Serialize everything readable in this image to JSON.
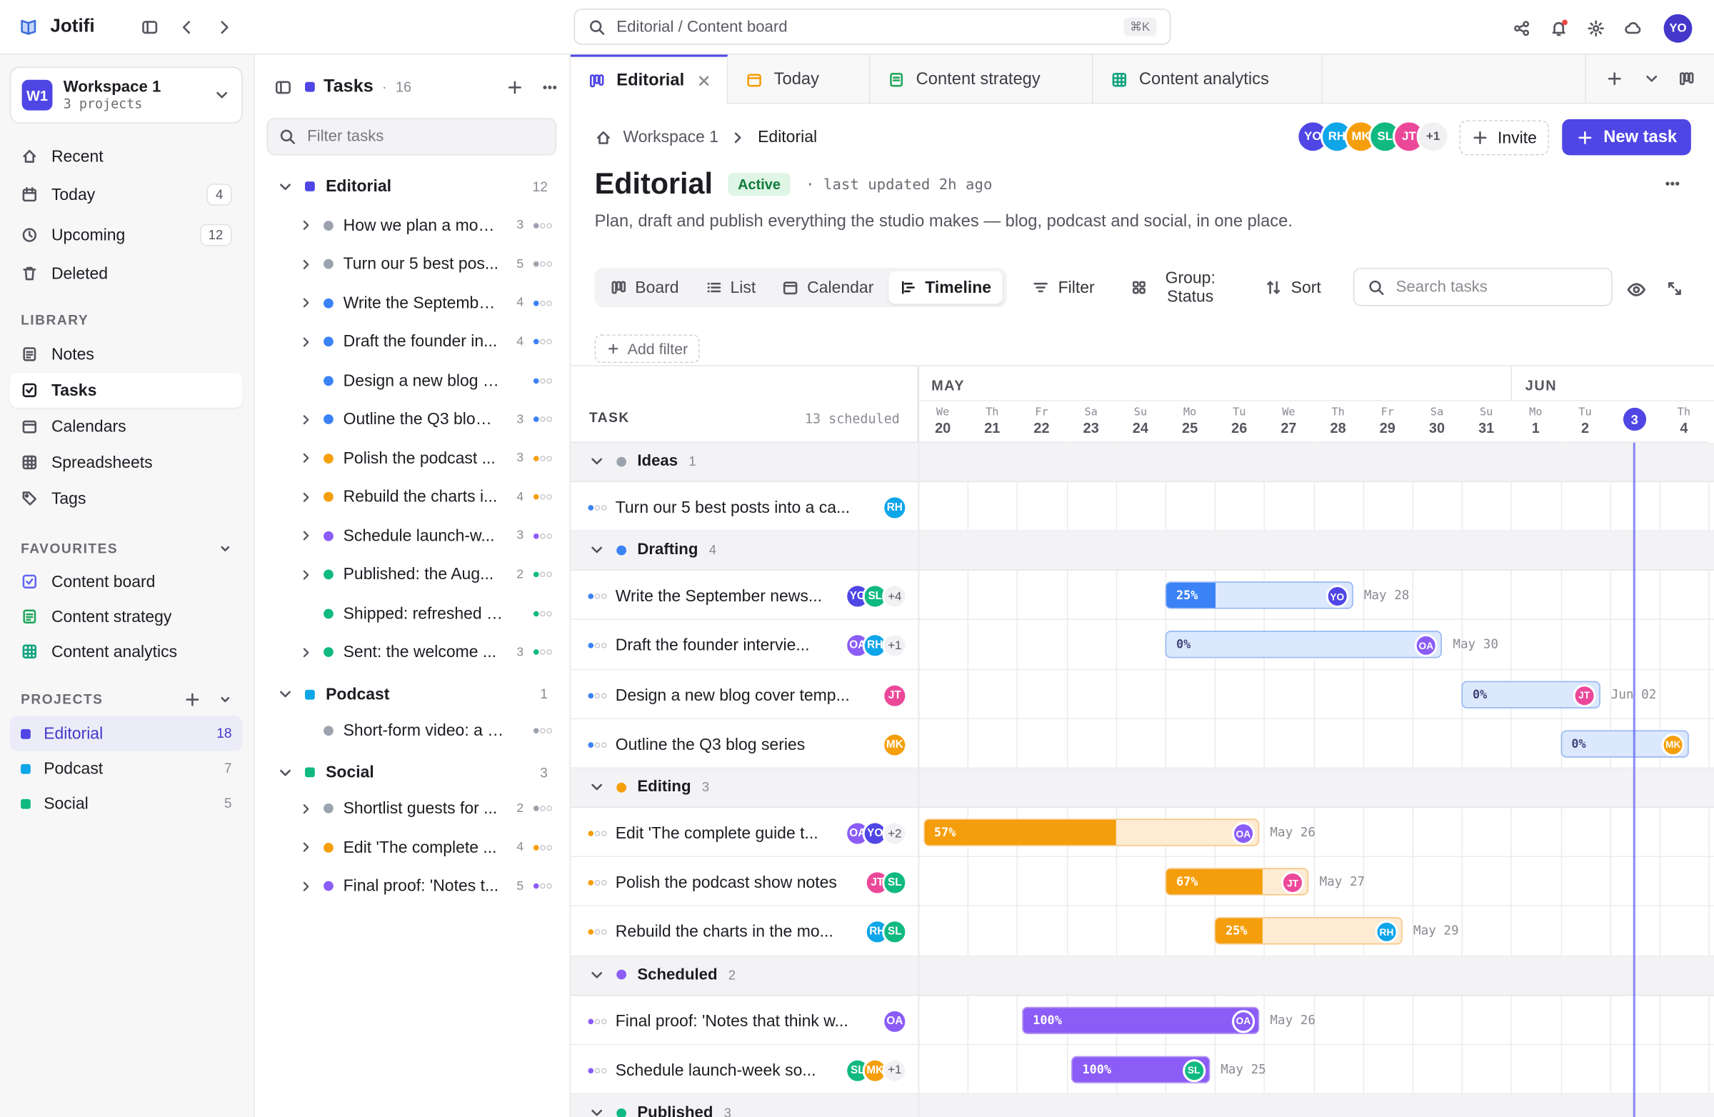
{
  "app": {
    "name": "Jotifi",
    "search": "Editorial / Content board",
    "shortcut": "⌘K",
    "user": "YO"
  },
  "workspace": {
    "name": "Workspace 1",
    "badge": "W1",
    "sub": "3 projects"
  },
  "nav": [
    {
      "label": "Recent",
      "icon": "clock-rewind-icon"
    },
    {
      "label": "Today",
      "count": "4",
      "icon": "calendar-icon"
    },
    {
      "label": "Upcoming",
      "count": "12",
      "icon": "clock-icon"
    },
    {
      "label": "Deleted",
      "icon": "trash-icon"
    }
  ],
  "library": {
    "title": "LIBRARY",
    "items": [
      "Notes",
      "Tasks",
      "Calendars",
      "Spreadsheets",
      "Tags"
    ]
  },
  "favourites": {
    "title": "FAVOURITES",
    "items": [
      "Content board",
      "Content strategy",
      "Content analytics"
    ]
  },
  "projects": {
    "title": "PROJECTS",
    "items": [
      {
        "label": "Editorial",
        "count": "18",
        "color": "#4f46e5"
      },
      {
        "label": "Podcast",
        "count": "7",
        "color": "#0ea5e9"
      },
      {
        "label": "Social",
        "count": "5",
        "color": "#10b981"
      }
    ]
  },
  "tasks_panel": {
    "title": "Tasks",
    "count": "16",
    "filter_placeholder": "Filter tasks",
    "groups": [
      {
        "name": "Editorial",
        "count": "12",
        "color": "#4f46e5",
        "items": [
          {
            "t": "How we plan a mon...",
            "n": "3",
            "c": "#9ca3af"
          },
          {
            "t": "Turn our 5 best pos...",
            "n": "5",
            "c": "#9ca3af"
          },
          {
            "t": "Write the Septembe...",
            "n": "4",
            "c": "#3b82f6"
          },
          {
            "t": "Draft the founder in...",
            "n": "4",
            "c": "#3b82f6"
          },
          {
            "t": "Design a new blog co...",
            "n": "",
            "c": "#3b82f6"
          },
          {
            "t": "Outline the Q3 blog ...",
            "n": "3",
            "c": "#3b82f6"
          },
          {
            "t": "Polish the podcast ...",
            "n": "3",
            "c": "#f59e0b"
          },
          {
            "t": "Rebuild the charts i...",
            "n": "4",
            "c": "#f59e0b"
          },
          {
            "t": "Schedule launch-w...",
            "n": "3",
            "c": "#8b5cf6"
          },
          {
            "t": "Published: the Aug...",
            "n": "2",
            "c": "#10b981"
          },
          {
            "t": "Shipped: refreshed br...",
            "n": "",
            "c": "#10b981"
          },
          {
            "t": "Sent: the welcome ...",
            "n": "3",
            "c": "#10b981"
          }
        ]
      },
      {
        "name": "Podcast",
        "count": "1",
        "color": "#0ea5e9",
        "items": [
          {
            "t": "Short-form video: a d...",
            "n": "",
            "c": "#9ca3af"
          }
        ]
      },
      {
        "name": "Social",
        "count": "3",
        "color": "#10b981",
        "items": [
          {
            "t": "Shortlist guests for ...",
            "n": "2",
            "c": "#9ca3af"
          },
          {
            "t": "Edit 'The complete ...",
            "n": "4",
            "c": "#f59e0b"
          },
          {
            "t": "Final proof: 'Notes t...",
            "n": "5",
            "c": "#8b5cf6"
          }
        ]
      }
    ]
  },
  "tabs": [
    {
      "label": "Editorial",
      "icon": "board-icon"
    },
    {
      "label": "Today",
      "icon": "calendar-icon"
    },
    {
      "label": "Content strategy",
      "icon": "doc-icon"
    },
    {
      "label": "Content analytics",
      "icon": "table-icon"
    }
  ],
  "page": {
    "crumb_root": "Workspace 1",
    "crumb_current": "Editorial",
    "title": "Editorial",
    "status": "Active",
    "updated": "· last updated 2h ago",
    "description": "Plan, draft and publish everything the studio makes — blog, podcast and social, in one place.",
    "invite": "Invite",
    "new_task": "New task",
    "members_more": "+1"
  },
  "views": [
    "Board",
    "List",
    "Calendar",
    "Timeline"
  ],
  "toolbar": {
    "filter": "Filter",
    "group": "Group:",
    "group_val": "Status",
    "sort": "Sort",
    "search_placeholder": "Search tasks",
    "add_filter": "Add filter"
  },
  "timeline": {
    "task_label": "TASK",
    "scheduled": "13 scheduled",
    "months": [
      "MAY",
      "JUN"
    ],
    "days": [
      [
        "We",
        "20"
      ],
      [
        "Th",
        "21"
      ],
      [
        "Fr",
        "22"
      ],
      [
        "Sa",
        "23"
      ],
      [
        "Su",
        "24"
      ],
      [
        "Mo",
        "25"
      ],
      [
        "Tu",
        "26"
      ],
      [
        "We",
        "27"
      ],
      [
        "Th",
        "28"
      ],
      [
        "Fr",
        "29"
      ],
      [
        "Sa",
        "30"
      ],
      [
        "Su",
        "31"
      ],
      [
        "Mo",
        "1"
      ],
      [
        "Tu",
        "2"
      ],
      [
        "",
        "3"
      ],
      [
        "Th",
        "4"
      ]
    ],
    "rows": [
      {
        "group": "Ideas",
        "n": "1",
        "c": "#9ca3af"
      },
      {
        "task": "Turn our 5 best posts into a ca...",
        "avs": [
          [
            "RH",
            "#0ea5e9"
          ]
        ],
        "more": ""
      },
      {
        "group": "Drafting",
        "n": "4",
        "c": "#3b82f6"
      },
      {
        "task": "Write the September news...",
        "avs": [
          [
            "YO",
            "#4f46e5"
          ],
          [
            "SL",
            "#10b981"
          ]
        ],
        "more": "+4",
        "bar": {
          "s": 5,
          "e": 8.8,
          "p": "25%",
          "pv": 0.25,
          "kind": "blue",
          "av": [
            "YO",
            "#4f46e5"
          ],
          "due": "May 28"
        }
      },
      {
        "task": "Draft the founder intervie...",
        "avs": [
          [
            "OA",
            "#8b5cf6"
          ],
          [
            "RH",
            "#0ea5e9"
          ]
        ],
        "more": "+1",
        "bar": {
          "s": 5,
          "e": 10.6,
          "p": "0%",
          "pv": 0,
          "kind": "blue",
          "av": [
            "OA",
            "#8b5cf6"
          ],
          "due": "May 30"
        }
      },
      {
        "task": "Design a new blog cover temp...",
        "avs": [
          [
            "JT",
            "#ec4899"
          ]
        ],
        "more": "",
        "bar": {
          "s": 11,
          "e": 13.8,
          "p": "0%",
          "pv": 0,
          "kind": "blue",
          "av": [
            "JT",
            "#ec4899"
          ],
          "due": "Jun 02"
        }
      },
      {
        "task": "Outline the Q3 blog series",
        "avs": [
          [
            "MK",
            "#f59e0b"
          ]
        ],
        "more": "",
        "bar": {
          "s": 13,
          "e": 15.6,
          "p": "0%",
          "pv": 0,
          "kind": "blue",
          "av": [
            "MK",
            "#f59e0b"
          ],
          "due": ""
        }
      },
      {
        "group": "Editing",
        "n": "3",
        "c": "#f59e0b"
      },
      {
        "task": "Edit 'The complete guide t...",
        "avs": [
          [
            "OA",
            "#8b5cf6"
          ],
          [
            "YO",
            "#4f46e5"
          ]
        ],
        "more": "+2",
        "bar": {
          "s": 0.1,
          "e": 6.9,
          "p": "57%",
          "pv": 0.57,
          "kind": "orange",
          "av": [
            "OA",
            "#8b5cf6"
          ],
          "due": "May 26"
        }
      },
      {
        "task": "Polish the podcast show notes",
        "avs": [
          [
            "JT",
            "#ec4899"
          ],
          [
            "SL",
            "#10b981"
          ]
        ],
        "more": "",
        "bar": {
          "s": 5,
          "e": 7.9,
          "p": "67%",
          "pv": 0.67,
          "kind": "orange",
          "av": [
            "JT",
            "#ec4899"
          ],
          "due": "May 27"
        }
      },
      {
        "task": "Rebuild the charts in the mo...",
        "avs": [
          [
            "RH",
            "#0ea5e9"
          ],
          [
            "SL",
            "#10b981"
          ]
        ],
        "more": "",
        "bar": {
          "s": 6,
          "e": 9.8,
          "p": "25%",
          "pv": 0.25,
          "kind": "orange",
          "av": [
            "RH",
            "#0ea5e9"
          ],
          "due": "May 29"
        }
      },
      {
        "group": "Scheduled",
        "n": "2",
        "c": "#8b5cf6"
      },
      {
        "task": "Final proof: 'Notes that think w...",
        "avs": [
          [
            "OA",
            "#8b5cf6"
          ]
        ],
        "more": "",
        "bar": {
          "s": 2.1,
          "e": 6.9,
          "p": "100%",
          "pv": 1,
          "kind": "purple",
          "av": [
            "OA",
            "#8b5cf6"
          ],
          "due": "May 26"
        }
      },
      {
        "task": "Schedule launch-week so...",
        "avs": [
          [
            "SL",
            "#10b981"
          ],
          [
            "MK",
            "#f59e0b"
          ]
        ],
        "more": "+1",
        "bar": {
          "s": 3.1,
          "e": 5.9,
          "p": "100%",
          "pv": 1,
          "kind": "purple",
          "av": [
            "SL",
            "#10b981"
          ],
          "due": "May 25"
        }
      },
      {
        "group": "Published",
        "n": "3",
        "c": "#10b981"
      }
    ]
  }
}
